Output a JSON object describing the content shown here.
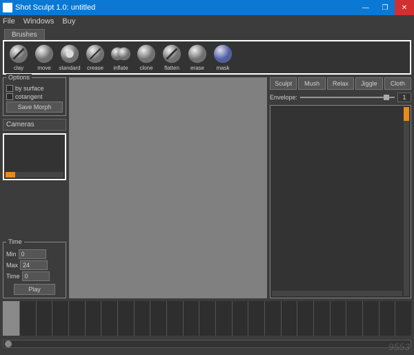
{
  "title": "Shot Sculpt 1.0: untitled",
  "win": {
    "min": "—",
    "max": "❐",
    "close": "✕"
  },
  "menu": [
    "File",
    "Windows",
    "Buy"
  ],
  "tab": "Brushes",
  "brushes": [
    "clay",
    "move",
    "standard",
    "crease",
    "inflate",
    "clone",
    "flatten",
    "erase",
    "mask"
  ],
  "options": {
    "label": "Options",
    "by_surface": "by surface",
    "cotangent": "cotangent",
    "save": "Save Morph"
  },
  "cameras": "Cameras",
  "time": {
    "label": "Time",
    "min_label": "Min",
    "min": "0",
    "max_label": "Max",
    "max": "24",
    "time_label": "Time",
    "time_val": "0",
    "play": "Play"
  },
  "modes": [
    "Sculpt",
    "Mush",
    "Relax",
    "Jiggle",
    "Cloth"
  ],
  "envelope": {
    "label": "Envelope:",
    "value": "1"
  },
  "watermark": "9553"
}
